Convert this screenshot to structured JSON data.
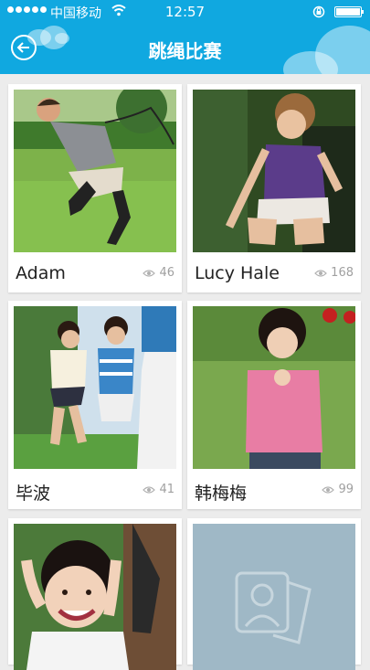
{
  "status_bar": {
    "carrier": "中国移动",
    "time": "12:57"
  },
  "nav": {
    "title": "跳绳比赛",
    "back_icon": "arrow-left-circle-icon"
  },
  "cards": [
    {
      "name": "Adam",
      "views": "46",
      "photo": "boy jumping rope on grass"
    },
    {
      "name": "Lucy Hale",
      "views": "168",
      "photo": "girl in purple top jumping"
    },
    {
      "name": "毕波",
      "views": "41",
      "photo": "children jumping rope outdoors"
    },
    {
      "name": "韩梅梅",
      "views": "99",
      "photo": "girl in pink jacket holding rope"
    },
    {
      "name": "",
      "views": "",
      "photo": "smiling child with hands on head"
    },
    {
      "name": "",
      "views": "",
      "photo": "placeholder portrait icon"
    }
  ],
  "colors": {
    "primary": "#10a8e0",
    "background": "#ececec",
    "placeholder": "#9fb8c6"
  }
}
